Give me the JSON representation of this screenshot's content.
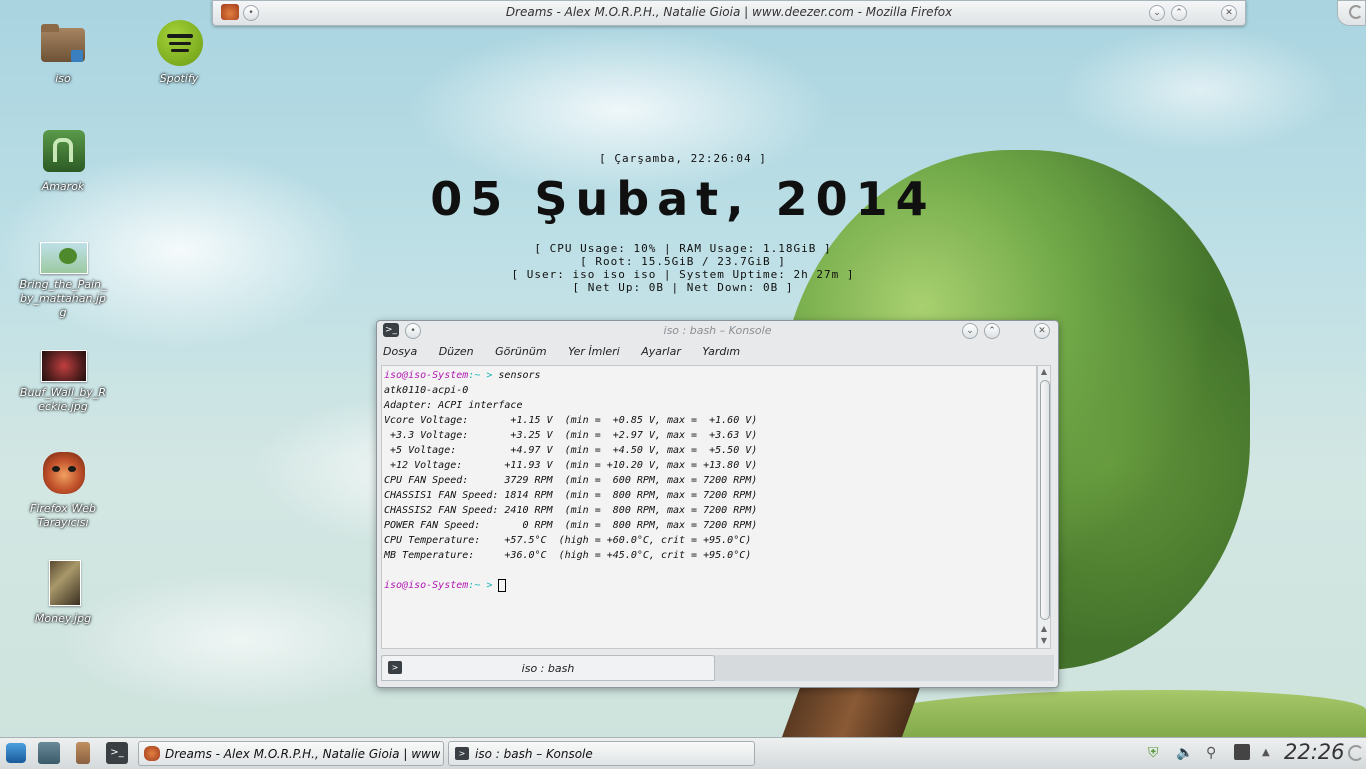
{
  "firefox": {
    "title": "Dreams - Alex M.O.R.P.H., Natalie Gioia | www.deezer.com - Mozilla Firefox"
  },
  "desktop_icons": [
    {
      "label": "iso"
    },
    {
      "label": "Spotify"
    },
    {
      "label": "Amarok"
    },
    {
      "label": "Bring_the_Pain_by_mattahan.jpg"
    },
    {
      "label": "Buuf_Wall_by_Reckie.jpg"
    },
    {
      "label": "Firefox Web Tarayıcısı"
    },
    {
      "label": "Money.jpg"
    }
  ],
  "conky": {
    "datetime": "[ Çarşamba, 22:26:04 ]",
    "date_big": "05 Şubat, 2014",
    "lines": [
      "[ CPU Usage: 10% | RAM Usage: 1.18GiB ]",
      "[ Root: 15.5GiB / 23.7GiB ]",
      "[ User: iso iso iso | System Uptime: 2h 27m ]",
      "[ Net Up: 0B | Net Down: 0B ]"
    ]
  },
  "konsole": {
    "title": "iso : bash – Konsole",
    "menu": [
      "Dosya",
      "Düzen",
      "Görünüm",
      "Yer İmleri",
      "Ayarlar",
      "Yardım"
    ],
    "prompt_user": "iso@iso-System",
    "prompt_sep": ":~ >",
    "command": " sensors",
    "output": [
      "atk0110-acpi-0",
      "Adapter: ACPI interface",
      "Vcore Voltage:       +1.15 V  (min =  +0.85 V, max =  +1.60 V)",
      " +3.3 Voltage:       +3.25 V  (min =  +2.97 V, max =  +3.63 V)",
      " +5 Voltage:         +4.97 V  (min =  +4.50 V, max =  +5.50 V)",
      " +12 Voltage:       +11.93 V  (min = +10.20 V, max = +13.80 V)",
      "CPU FAN Speed:      3729 RPM  (min =  600 RPM, max = 7200 RPM)",
      "CHASSIS1 FAN Speed: 1814 RPM  (min =  800 RPM, max = 7200 RPM)",
      "CHASSIS2 FAN Speed: 2410 RPM  (min =  800 RPM, max = 7200 RPM)",
      "POWER FAN Speed:       0 RPM  (min =  800 RPM, max = 7200 RPM)",
      "CPU Temperature:    +57.5°C  (high = +60.0°C, crit = +95.0°C)",
      "MB Temperature:     +36.0°C  (high = +45.0°C, crit = +95.0°C)"
    ],
    "tab_label": "iso : bash"
  },
  "taskbar": {
    "tasks": [
      {
        "label": "Dreams - Alex M.O.R.P.H., Natalie Gioia | www.dee"
      },
      {
        "label": "iso : bash – Konsole"
      }
    ],
    "clock": "22:26"
  },
  "colors": {
    "prompt_user": "#b218b2",
    "prompt_sep": "#18b2b2"
  }
}
